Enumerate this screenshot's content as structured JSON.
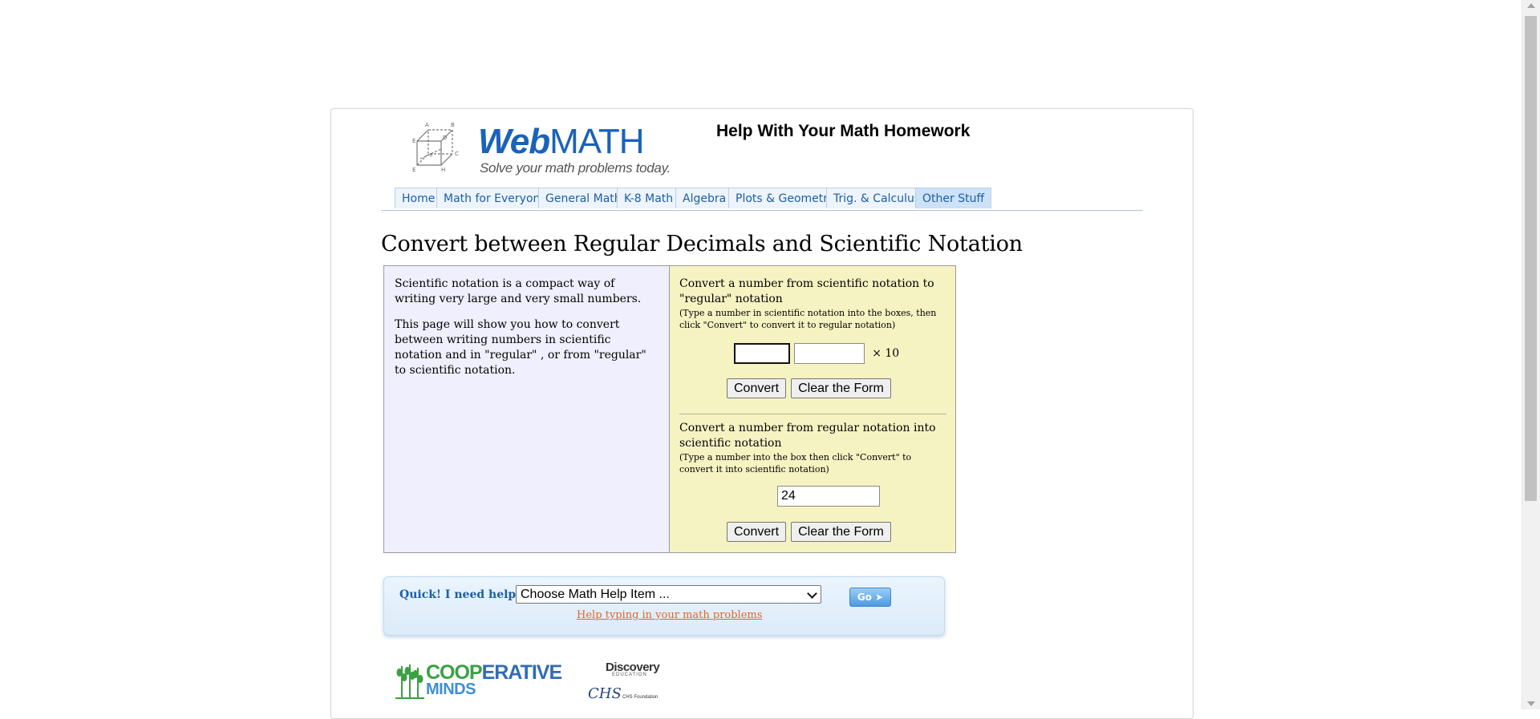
{
  "header": {
    "logo_word_web": "Web",
    "logo_word_math": "MATH",
    "logo_tagline": "Solve your math problems today.",
    "title": "Help With Your Math Homework"
  },
  "nav": {
    "tabs": [
      {
        "label": "Home"
      },
      {
        "label": "Math for Everyone"
      },
      {
        "label": "General Math"
      },
      {
        "label": "K-8 Math"
      },
      {
        "label": "Algebra"
      },
      {
        "label": "Plots & Geometry"
      },
      {
        "label": "Trig. & Calculus"
      },
      {
        "label": "Other Stuff"
      }
    ],
    "active_tab": "Other Stuff"
  },
  "main": {
    "title": "Convert between Regular Decimals and Scientific Notation",
    "intro_1": "Scientific notation is a compact way of writing very large and very small numbers.",
    "intro_2": "This page will show you how to convert between writing numbers in scientific notation and in \"regular\" , or from \"regular\" to scientific notation."
  },
  "form_sci_to_regular": {
    "title": "Convert a number from scientific notation to \"regular\" notation",
    "note": "(Type a number in scientific notation into the boxes, then click \"Convert\" to convert it to regular notation)",
    "mantissa_value": "",
    "exponent_value": "",
    "times_label": "× 10",
    "convert_label": "Convert",
    "clear_label": "Clear the Form"
  },
  "form_regular_to_sci": {
    "title": "Convert a number from regular notation into scientific notation",
    "note": "(Type a number into the box then click \"Convert\" to convert it into scientific notation)",
    "number_value": "24",
    "convert_label": "Convert",
    "clear_label": "Clear the Form"
  },
  "quick_help": {
    "label": "Quick! I need help with:",
    "select_value": "Choose Math Help Item ...",
    "go_label": "Go ➤",
    "link": "Help typing in your math problems"
  },
  "sponsors": {
    "coop_top_a": "COOP",
    "coop_top_b": "ERATIVE",
    "coop_bottom": "MINDS",
    "discovery": "Discovery",
    "discovery_sub": "EDUCATION",
    "chs": "CHS",
    "chs_sub": "CHS Foundation"
  },
  "colors": {
    "accent": "#1a63b8",
    "left_panel_bg": "#efeffd",
    "right_panel_bg": "#f6f3c3",
    "link": "#e2652a"
  }
}
